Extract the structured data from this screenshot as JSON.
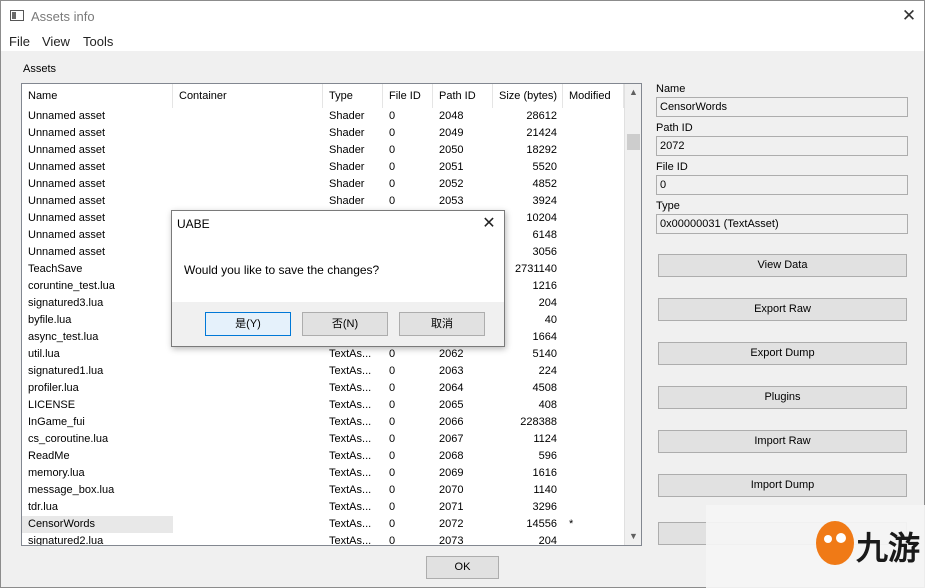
{
  "window": {
    "title": "Assets info"
  },
  "menu": [
    "File",
    "View",
    "Tools"
  ],
  "assets_label": "Assets",
  "columns": [
    "Name",
    "Container",
    "Type",
    "File ID",
    "Path ID",
    "Size (bytes)",
    "Modified"
  ],
  "rows": [
    {
      "name": "Unnamed asset",
      "container": "",
      "type": "Shader",
      "file_id": "0",
      "path_id": "2048",
      "size": "28612",
      "modified": ""
    },
    {
      "name": "Unnamed asset",
      "container": "",
      "type": "Shader",
      "file_id": "0",
      "path_id": "2049",
      "size": "21424",
      "modified": ""
    },
    {
      "name": "Unnamed asset",
      "container": "",
      "type": "Shader",
      "file_id": "0",
      "path_id": "2050",
      "size": "18292",
      "modified": ""
    },
    {
      "name": "Unnamed asset",
      "container": "",
      "type": "Shader",
      "file_id": "0",
      "path_id": "2051",
      "size": "5520",
      "modified": ""
    },
    {
      "name": "Unnamed asset",
      "container": "",
      "type": "Shader",
      "file_id": "0",
      "path_id": "2052",
      "size": "4852",
      "modified": ""
    },
    {
      "name": "Unnamed asset",
      "container": "",
      "type": "Shader",
      "file_id": "0",
      "path_id": "2053",
      "size": "3924",
      "modified": ""
    },
    {
      "name": "Unnamed asset",
      "container": "",
      "type": "",
      "file_id": "",
      "path_id": "",
      "size": "10204",
      "modified": ""
    },
    {
      "name": "Unnamed asset",
      "container": "",
      "type": "",
      "file_id": "",
      "path_id": "",
      "size": "6148",
      "modified": ""
    },
    {
      "name": "Unnamed asset",
      "container": "",
      "type": "",
      "file_id": "",
      "path_id": "",
      "size": "3056",
      "modified": ""
    },
    {
      "name": "TeachSave",
      "container": "",
      "type": "",
      "file_id": "",
      "path_id": "",
      "size": "2731140",
      "modified": ""
    },
    {
      "name": "coruntine_test.lua",
      "container": "",
      "type": "",
      "file_id": "",
      "path_id": "",
      "size": "1216",
      "modified": ""
    },
    {
      "name": "signatured3.lua",
      "container": "",
      "type": "",
      "file_id": "",
      "path_id": "",
      "size": "204",
      "modified": ""
    },
    {
      "name": "byfile.lua",
      "container": "",
      "type": "",
      "file_id": "",
      "path_id": "",
      "size": "40",
      "modified": ""
    },
    {
      "name": "async_test.lua",
      "container": "",
      "type": "",
      "file_id": "",
      "path_id": "",
      "size": "1664",
      "modified": ""
    },
    {
      "name": "util.lua",
      "container": "",
      "type": "TextAs...",
      "file_id": "0",
      "path_id": "2062",
      "size": "5140",
      "modified": ""
    },
    {
      "name": "signatured1.lua",
      "container": "",
      "type": "TextAs...",
      "file_id": "0",
      "path_id": "2063",
      "size": "224",
      "modified": ""
    },
    {
      "name": "profiler.lua",
      "container": "",
      "type": "TextAs...",
      "file_id": "0",
      "path_id": "2064",
      "size": "4508",
      "modified": ""
    },
    {
      "name": "LICENSE",
      "container": "",
      "type": "TextAs...",
      "file_id": "0",
      "path_id": "2065",
      "size": "408",
      "modified": ""
    },
    {
      "name": "InGame_fui",
      "container": "",
      "type": "TextAs...",
      "file_id": "0",
      "path_id": "2066",
      "size": "228388",
      "modified": ""
    },
    {
      "name": "cs_coroutine.lua",
      "container": "",
      "type": "TextAs...",
      "file_id": "0",
      "path_id": "2067",
      "size": "1124",
      "modified": ""
    },
    {
      "name": "ReadMe",
      "container": "",
      "type": "TextAs...",
      "file_id": "0",
      "path_id": "2068",
      "size": "596",
      "modified": ""
    },
    {
      "name": "memory.lua",
      "container": "",
      "type": "TextAs...",
      "file_id": "0",
      "path_id": "2069",
      "size": "1616",
      "modified": ""
    },
    {
      "name": "message_box.lua",
      "container": "",
      "type": "TextAs...",
      "file_id": "0",
      "path_id": "2070",
      "size": "1140",
      "modified": ""
    },
    {
      "name": "tdr.lua",
      "container": "",
      "type": "TextAs...",
      "file_id": "0",
      "path_id": "2071",
      "size": "3296",
      "modified": ""
    },
    {
      "name": "CensorWords",
      "container": "",
      "type": "TextAs...",
      "file_id": "0",
      "path_id": "2072",
      "size": "14556",
      "modified": "*",
      "selected": true
    },
    {
      "name": "signatured2.lua",
      "container": "",
      "type": "TextAs...",
      "file_id": "0",
      "path_id": "2073",
      "size": "204",
      "modified": ""
    }
  ],
  "details": {
    "name_label": "Name",
    "name_value": "CensorWords",
    "path_id_label": "Path ID",
    "path_id_value": "2072",
    "file_id_label": "File ID",
    "file_id_value": "0",
    "type_label": "Type",
    "type_value": "0x00000031 (TextAsset)"
  },
  "buttons": [
    "View Data",
    "Export Raw",
    "Export Dump",
    "Plugins",
    "Import Raw",
    "Import Dump"
  ],
  "ok_label": "OK",
  "dialog": {
    "title": "UABE",
    "message": "Would you like to save the changes?",
    "yes": "是(Y)",
    "no": "否(N)",
    "cancel": "取消"
  },
  "watermark": {
    "text": "九游"
  },
  "icons": {
    "app": "window-icon",
    "close": "close-icon",
    "scroll_up": "arrow-up-icon",
    "scroll_down": "arrow-down-icon"
  }
}
